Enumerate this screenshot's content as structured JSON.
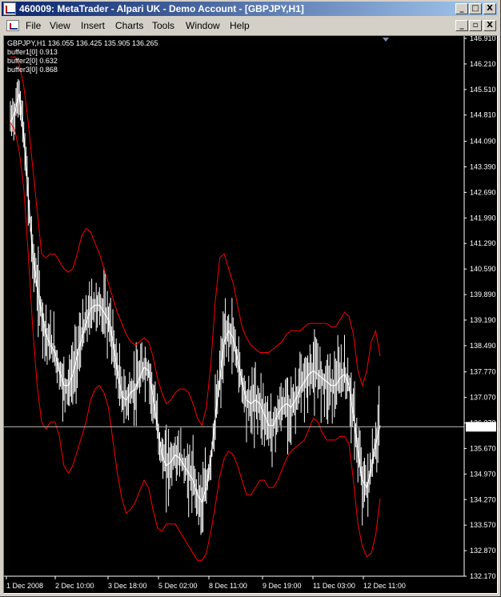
{
  "window": {
    "title": "460009: MetaTrader - Alpari UK - Demo Account - [GBPJPY,H1]",
    "minimize": "_",
    "maximize": "□",
    "close": "X"
  },
  "menu": {
    "items": [
      "File",
      "View",
      "Insert",
      "Charts",
      "Tools",
      "Window",
      "Help"
    ]
  },
  "mdi": {
    "minimize": "_",
    "restore": "▫",
    "close": "X"
  },
  "chart": {
    "header": "GBPJPY,H1  136.055 136.425 135.905 136.265",
    "buffers": [
      "buffer1[0] 0.913",
      "buffer2[0] 0.632",
      "buffer3[0] 0.868"
    ],
    "current_price_label": "136.265",
    "colors": {
      "background": "#000000",
      "bars": "#ffffff",
      "bands": "#ff0000",
      "axis_text": "#ffffff"
    }
  },
  "chart_data": {
    "type": "line",
    "symbol": "GBPJPY",
    "timeframe": "H1",
    "ylim": [
      132.17,
      146.91
    ],
    "yticks": [
      "146.910",
      "146.210",
      "145.510",
      "144.810",
      "144.090",
      "143.390",
      "142.690",
      "141.990",
      "141.290",
      "140.590",
      "139.890",
      "139.190",
      "138.490",
      "137.770",
      "137.070",
      "136.370",
      "135.670",
      "134.970",
      "134.270",
      "133.570",
      "132.870",
      "132.170"
    ],
    "xticks": [
      "1 Dec 2008",
      "2 Dec 10:00",
      "3 Dec 18:00",
      "5 Dec 02:00",
      "8 Dec 11:00",
      "9 Dec 19:00",
      "11 Dec 03:00",
      "12 Dec 11:00"
    ],
    "current_price": 136.265,
    "series": [
      {
        "values": [
          144.6,
          144.9,
          145.4,
          144.2,
          142.6,
          141.0,
          140.1,
          139.4,
          138.8,
          138.5,
          138.3,
          137.8,
          137.4,
          137.4,
          137.7,
          138.2,
          138.7,
          139.1,
          139.5,
          139.6,
          139.6,
          139.4,
          139.2,
          138.6,
          137.8,
          137.1,
          137.0,
          137.2,
          137.3,
          137.6,
          137.9,
          137.8,
          137.1,
          136.3,
          135.5,
          135.2,
          135.3,
          135.5,
          135.4,
          135.2,
          135.0,
          134.8,
          134.4,
          134.2,
          134.6,
          135.4,
          136.5,
          137.6,
          138.6,
          138.9,
          138.7,
          138.1,
          137.5,
          137.0,
          136.9,
          137.0,
          136.9,
          136.6,
          136.3,
          136.3,
          136.6,
          136.8,
          136.9,
          136.8,
          137.0,
          137.3,
          137.5,
          137.7,
          137.8,
          137.7,
          137.6,
          137.5,
          137.4,
          137.4,
          137.6,
          137.7,
          137.4,
          136.6,
          135.6,
          134.8,
          134.6,
          135.1,
          135.8,
          136.3
        ]
      },
      {
        "values": [
          146.4,
          146.4,
          146.2,
          145.6,
          144.6,
          143.4,
          142.2,
          141.0,
          140.9,
          141.0,
          141.0,
          140.8,
          140.6,
          140.5,
          140.6,
          141.0,
          141.5,
          141.7,
          141.6,
          141.3,
          141.0,
          140.6,
          140.2,
          139.8,
          139.4,
          139.1,
          138.8,
          138.6,
          138.5,
          138.6,
          138.7,
          138.6,
          138.2,
          137.6,
          137.2,
          136.9,
          137.0,
          137.2,
          137.3,
          137.3,
          137.2,
          136.9,
          136.5,
          136.3,
          136.8,
          138.0,
          139.7,
          140.9,
          141.0,
          140.6,
          140.2,
          139.6,
          139.0,
          138.7,
          138.5,
          138.4,
          138.3,
          138.3,
          138.3,
          138.4,
          138.5,
          138.6,
          138.8,
          138.9,
          138.9,
          138.9,
          139.0,
          139.1,
          139.1,
          139.1,
          139.1,
          139.1,
          139.0,
          139.0,
          139.2,
          139.4,
          139.3,
          138.8,
          137.8,
          137.4,
          137.8,
          138.6,
          138.9,
          138.2
        ]
      },
      {
        "values": [
          144.6,
          144.4,
          143.8,
          142.8,
          141.0,
          139.0,
          137.4,
          136.4,
          136.2,
          136.4,
          136.4,
          136.0,
          135.2,
          135.0,
          135.2,
          135.6,
          136.0,
          136.4,
          137.0,
          137.3,
          137.4,
          137.2,
          136.8,
          135.9,
          135.0,
          134.3,
          133.9,
          134.0,
          134.2,
          134.5,
          134.8,
          134.6,
          134.0,
          133.5,
          133.4,
          133.6,
          133.6,
          133.6,
          133.4,
          133.2,
          133.0,
          132.8,
          132.6,
          132.6,
          132.8,
          133.4,
          134.1,
          134.9,
          135.4,
          135.6,
          135.5,
          135.2,
          134.8,
          134.4,
          134.4,
          134.6,
          134.8,
          134.8,
          134.6,
          134.6,
          134.8,
          135.1,
          135.4,
          135.6,
          135.7,
          135.8,
          135.9,
          136.2,
          136.5,
          136.4,
          136.1,
          135.9,
          135.9,
          135.9,
          136.0,
          136.0,
          135.8,
          134.8,
          133.6,
          133.0,
          132.7,
          132.8,
          133.3,
          134.3
        ]
      }
    ]
  }
}
